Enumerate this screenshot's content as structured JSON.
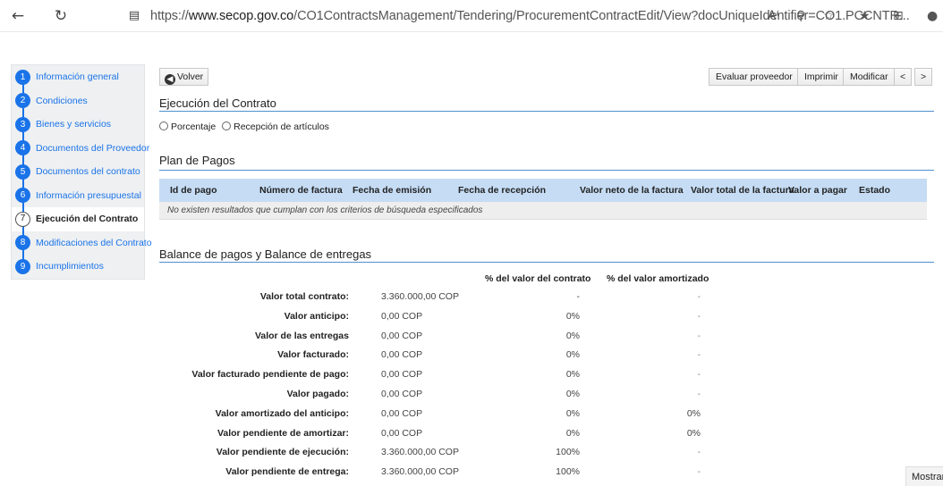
{
  "browser": {
    "url_prefix": "https://",
    "url_host": "www.secop.gov.co",
    "url_path": "/CO1ContractsManagement/Tendering/ProcurementContractEdit/View?docUniqueIdentifier=CO1.PCCNTR..."
  },
  "sidebar": {
    "items": [
      {
        "num": "1",
        "label": "Información general"
      },
      {
        "num": "2",
        "label": "Condiciones"
      },
      {
        "num": "3",
        "label": "Bienes y servicios"
      },
      {
        "num": "4",
        "label": "Documentos del Proveedor"
      },
      {
        "num": "5",
        "label": "Documentos del contrato"
      },
      {
        "num": "6",
        "label": "Información presupuestal"
      },
      {
        "num": "7",
        "label": "Ejecución del Contrato"
      },
      {
        "num": "8",
        "label": "Modificaciones del Contrato"
      },
      {
        "num": "9",
        "label": "Incumplimientos"
      }
    ],
    "active_index": 6
  },
  "toolbar": {
    "back_label": "Volver",
    "evaluate_label": "Evaluar proveedor",
    "print_label": "Imprimir",
    "modify_label": "Modificar",
    "prev_label": "<",
    "next_label": ">"
  },
  "execution": {
    "title": "Ejecución del Contrato",
    "option_percentage": "Porcentaje",
    "option_reception": "Recepción de artículos"
  },
  "payment_plan": {
    "title": "Plan de Pagos",
    "columns": [
      "Id de pago",
      "Número de factura",
      "Fecha de emisión",
      "Fecha de recepción",
      "Valor neto de la factura",
      "Valor total de la factura",
      "Valor a pagar",
      "Estado"
    ],
    "empty_message": "No existen resultados que cumplan con los criterios de búsqueda especificados"
  },
  "balance": {
    "title": "Balance de pagos y Balance de entregas",
    "col_pct": "% del valor del contrato",
    "col_amort": "% del valor amortizado",
    "rows": [
      {
        "label": "Valor total contrato:",
        "value": "3.360.000,00 COP",
        "pct": "-",
        "amort": "-"
      },
      {
        "label": "Valor anticipo:",
        "value": "0,00 COP",
        "pct": "0%",
        "amort": "-"
      },
      {
        "label": "Valor de las entregas",
        "value": "0,00 COP",
        "pct": "0%",
        "amort": "-"
      },
      {
        "label": "Valor facturado:",
        "value": "0,00 COP",
        "pct": "0%",
        "amort": "-"
      },
      {
        "label": "Valor facturado pendiente de pago:",
        "value": "0,00 COP",
        "pct": "0%",
        "amort": "-"
      },
      {
        "label": "Valor pagado:",
        "value": "0,00 COP",
        "pct": "0%",
        "amort": "-"
      },
      {
        "label": "Valor amortizado del anticipo:",
        "value": "0,00 COP",
        "pct": "0%",
        "amort": "0%"
      },
      {
        "label": "Valor pendiente de amortizar:",
        "value": "0,00 COP",
        "pct": "0%",
        "amort": "0%"
      },
      {
        "label": "Valor pendiente de ejecución:",
        "value": "3.360.000,00 COP",
        "pct": "100%",
        "amort": "-"
      },
      {
        "label": "Valor pendiente de entrega:",
        "value": "3.360.000,00 COP",
        "pct": "100%",
        "amort": "-"
      }
    ]
  },
  "footer": {
    "show_label": "Mostrar"
  }
}
